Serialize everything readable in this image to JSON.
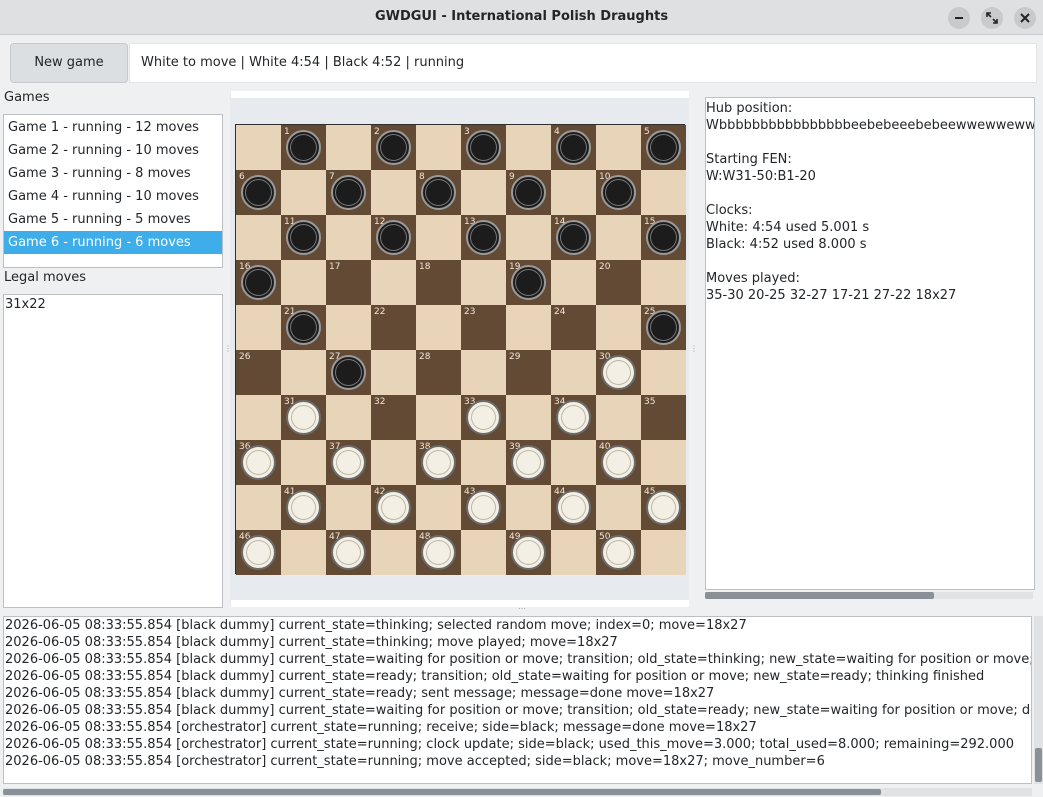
{
  "window": {
    "title": "GWDGUI - International Polish Draughts"
  },
  "toolbar": {
    "new_game_label": "New game",
    "status_text": "White to move | White 4:54 | Black 4:52 | running"
  },
  "games": {
    "label": "Games",
    "items": [
      {
        "label": "Game 1 - running - 12 moves",
        "selected": false
      },
      {
        "label": "Game 2 - running - 10 moves",
        "selected": false
      },
      {
        "label": "Game 3 - running - 8 moves",
        "selected": false
      },
      {
        "label": "Game 4 - running - 10 moves",
        "selected": false
      },
      {
        "label": "Game 5 - running - 5 moves",
        "selected": false
      },
      {
        "label": "Game 6 - running - 6 moves",
        "selected": true
      }
    ]
  },
  "legal_moves": {
    "label": "Legal moves",
    "items": [
      "31x22"
    ]
  },
  "board": {
    "size": 10,
    "pieces": {
      "black": [
        1,
        2,
        3,
        4,
        5,
        6,
        7,
        8,
        9,
        10,
        11,
        12,
        13,
        14,
        15,
        16,
        19,
        21,
        25,
        27
      ],
      "white": [
        30,
        31,
        33,
        34,
        36,
        37,
        38,
        39,
        40,
        41,
        42,
        43,
        44,
        45,
        46,
        47,
        48,
        49,
        50
      ]
    },
    "colors": {
      "light": "#e8d4b8",
      "dark": "#634a35"
    }
  },
  "info": {
    "lines": [
      "Hub position:",
      "Wbbbbbbbbbbbbbbbbeebebeeebebeewwewweww",
      "",
      "Starting FEN:",
      "W:W31-50:B1-20",
      "",
      "Clocks:",
      "White: 4:54 used 5.001 s",
      "Black: 4:52 used 8.000 s",
      "",
      "Moves played:",
      "35-30 20-25 32-27 17-21 27-22 18x27"
    ]
  },
  "log": {
    "lines": [
      "2026-06-05 08:33:55.854 [black dummy] current_state=thinking; selected random move; index=0; move=18x27",
      "2026-06-05 08:33:55.854 [black dummy] current_state=thinking; move played; move=18x27",
      "2026-06-05 08:33:55.854 [black dummy] current_state=waiting for position or move; transition; old_state=thinking; new_state=waiting for position or move; move re",
      "2026-06-05 08:33:55.854 [black dummy] current_state=ready; transition; old_state=waiting for position or move; new_state=ready; thinking finished",
      "2026-06-05 08:33:55.854 [black dummy] current_state=ready; sent message; message=done move=18x27",
      "2026-06-05 08:33:55.854 [black dummy] current_state=waiting for position or move; transition; old_state=ready; new_state=waiting for position or move; done sent",
      "2026-06-05 08:33:55.854 [orchestrator] current_state=running; receive; side=black; message=done move=18x27",
      "2026-06-05 08:33:55.854 [orchestrator] current_state=running; clock update; side=black; used_this_move=3.000; total_used=8.000; remaining=292.000",
      "2026-06-05 08:33:55.854 [orchestrator] current_state=running; move accepted; side=black; move=18x27; move_number=6"
    ]
  },
  "icons": {
    "minimize": "minimize-icon",
    "maximize": "maximize-icon",
    "close": "close-icon"
  }
}
